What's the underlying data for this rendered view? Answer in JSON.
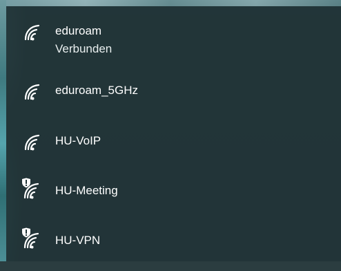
{
  "networks": [
    {
      "name": "eduroam",
      "status": "Verbunden",
      "icon": "wifi-icon",
      "secured_shield": false
    },
    {
      "name": "eduroam_5GHz",
      "icon": "wifi-icon",
      "secured_shield": false
    },
    {
      "name": "HU-VoIP",
      "icon": "wifi-icon",
      "secured_shield": false
    },
    {
      "name": "HU-Meeting",
      "icon": "wifi-shield-icon",
      "secured_shield": true
    },
    {
      "name": "HU-VPN",
      "icon": "wifi-shield-icon",
      "secured_shield": true
    }
  ],
  "colors": {
    "panel_bg": "#223437",
    "text": "#ffffff"
  }
}
